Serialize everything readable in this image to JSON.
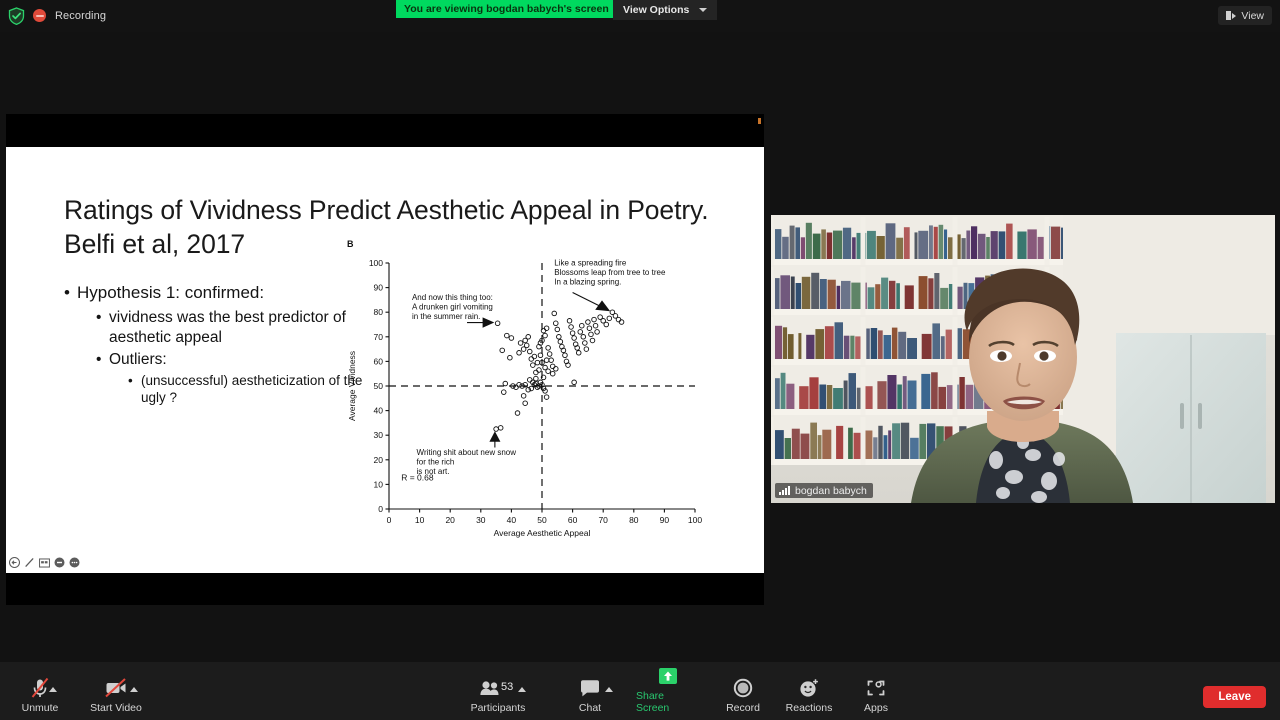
{
  "topbar": {
    "shield_icon": "shield-check-icon",
    "recording_icon": "recording-dot-icon",
    "recording_label": "Recording",
    "viewing_banner": "You are viewing bogdan babych's screen",
    "view_options_label": "View Options",
    "chevron_icon": "chevron-down-icon",
    "view_pill_label": "View",
    "view_pill_icon": "layout-view-icon"
  },
  "slide": {
    "title": "Ratings of Vividness Predict Aesthetic Appeal in Poetry. Belfi et al, 2017",
    "bullets": [
      {
        "level": 1,
        "text": "Hypothesis 1: confirmed:"
      },
      {
        "level": 2,
        "text": "vividness was the best predictor of aesthetic appeal"
      },
      {
        "level": 2,
        "text": "Outliers:"
      },
      {
        "level": 3,
        "text": "(unsuccessful) aestheticization of the ugly ?"
      }
    ],
    "ppt_toolbar_icons": [
      "pointer-icon",
      "pen-icon",
      "slides-grid-icon",
      "zoom-icon",
      "more-options-icon"
    ]
  },
  "chart_data": {
    "type": "scatter",
    "panel_label": "B",
    "title": "",
    "xlabel": "Average Aesthetic Appeal",
    "ylabel": "Average Vividness",
    "xlim": [
      0,
      100
    ],
    "ylim": [
      0,
      100
    ],
    "xticks": [
      0,
      10,
      20,
      30,
      40,
      50,
      60,
      70,
      80,
      90,
      100
    ],
    "yticks": [
      0,
      10,
      20,
      30,
      40,
      50,
      60,
      70,
      80,
      90,
      100
    ],
    "grid": false,
    "reference_lines": [
      {
        "orientation": "horizontal",
        "value": 50,
        "style": "dashed"
      },
      {
        "orientation": "vertical",
        "value": 50,
        "style": "dashed"
      }
    ],
    "stat_label": "R = 0.68",
    "marker": "open-circle",
    "annotations": [
      {
        "text": "And now this thing too:\nA drunken girl vomiting\nin the summer rain.",
        "points_to": [
          35.5,
          75.5
        ],
        "position": "left"
      },
      {
        "text": "Like a spreading fire\nBlossoms leap from tree to tree\nIn a blazing spring.",
        "points_to": [
          73,
          80
        ],
        "position": "top-right"
      },
      {
        "text": "Writing shit about new snow\nfor the rich\nis not art.",
        "points_to": [
          35.5,
          32.5
        ],
        "position": "bottom-left"
      }
    ],
    "points": [
      [
        35.5,
        75.5
      ],
      [
        38.5,
        70.5
      ],
      [
        40.0,
        69.5
      ],
      [
        37.0,
        64.5
      ],
      [
        39.5,
        61.5
      ],
      [
        42.5,
        63.5
      ],
      [
        43.0,
        67.5
      ],
      [
        44.0,
        65.0
      ],
      [
        44.5,
        68.5
      ],
      [
        45.0,
        66.5
      ],
      [
        45.5,
        70.0
      ],
      [
        46.0,
        64.0
      ],
      [
        46.5,
        61.0
      ],
      [
        47.0,
        58.5
      ],
      [
        47.5,
        62.0
      ],
      [
        48.0,
        55.5
      ],
      [
        48.5,
        59.5
      ],
      [
        49.0,
        66.0
      ],
      [
        49.5,
        67.5
      ],
      [
        50.0,
        68.5
      ],
      [
        50.5,
        72.5
      ],
      [
        51.0,
        70.5
      ],
      [
        51.5,
        73.5
      ],
      [
        52.0,
        65.5
      ],
      [
        52.5,
        63.0
      ],
      [
        53.0,
        60.5
      ],
      [
        53.5,
        58.0
      ],
      [
        54.0,
        79.5
      ],
      [
        54.5,
        75.5
      ],
      [
        55.0,
        73.0
      ],
      [
        55.5,
        70.0
      ],
      [
        56.0,
        68.0
      ],
      [
        56.5,
        66.0
      ],
      [
        57.0,
        64.5
      ],
      [
        57.5,
        62.5
      ],
      [
        58.0,
        60.0
      ],
      [
        58.5,
        58.5
      ],
      [
        59.0,
        76.5
      ],
      [
        59.5,
        74.0
      ],
      [
        60.0,
        71.5
      ],
      [
        60.5,
        69.5
      ],
      [
        61.0,
        67.0
      ],
      [
        61.5,
        65.5
      ],
      [
        62.0,
        63.5
      ],
      [
        62.5,
        72.0
      ],
      [
        63.0,
        74.5
      ],
      [
        63.5,
        70.0
      ],
      [
        64.0,
        67.5
      ],
      [
        64.5,
        65.0
      ],
      [
        65.0,
        76.0
      ],
      [
        65.5,
        73.5
      ],
      [
        66.0,
        71.0
      ],
      [
        66.5,
        68.5
      ],
      [
        67.0,
        77.0
      ],
      [
        67.5,
        74.5
      ],
      [
        68.0,
        72.0
      ],
      [
        69.0,
        78.0
      ],
      [
        70.0,
        76.5
      ],
      [
        71.0,
        75.0
      ],
      [
        72.0,
        77.5
      ],
      [
        73.0,
        80.0
      ],
      [
        74.0,
        78.5
      ],
      [
        75.0,
        77.0
      ],
      [
        76.0,
        76.0
      ],
      [
        38.0,
        51.0
      ],
      [
        40.5,
        50.0
      ],
      [
        41.5,
        49.5
      ],
      [
        42.5,
        50.5
      ],
      [
        43.5,
        50.0
      ],
      [
        44.5,
        50.5
      ],
      [
        45.5,
        48.5
      ],
      [
        46.5,
        49.0
      ],
      [
        47.5,
        50.5
      ],
      [
        48.0,
        51.0
      ],
      [
        48.5,
        49.5
      ],
      [
        49.0,
        50.0
      ],
      [
        49.5,
        51.5
      ],
      [
        50.0,
        50.5
      ],
      [
        50.5,
        49.0
      ],
      [
        51.0,
        48.0
      ],
      [
        51.5,
        45.5
      ],
      [
        60.5,
        51.5
      ],
      [
        37.5,
        47.5
      ],
      [
        44.0,
        46.0
      ],
      [
        44.5,
        43.0
      ],
      [
        42.0,
        39.0
      ],
      [
        35.0,
        32.5
      ],
      [
        36.5,
        33.0
      ],
      [
        50.5,
        53.5
      ],
      [
        49.0,
        56.5
      ],
      [
        48.0,
        53.0
      ],
      [
        47.0,
        51.5
      ],
      [
        46.0,
        52.5
      ],
      [
        53.5,
        55.0
      ],
      [
        54.5,
        57.0
      ],
      [
        52.0,
        56.0
      ],
      [
        51.0,
        57.5
      ],
      [
        50.0,
        59.5
      ],
      [
        49.5,
        62.5
      ],
      [
        51.5,
        60.5
      ]
    ]
  },
  "video": {
    "participant_name": "bogdan babych",
    "signal_icon": "signal-strength-icon"
  },
  "bottombar": {
    "controls": [
      {
        "label": "Unmute",
        "icon": "microphone-muted-icon",
        "has_caret": true,
        "active": false
      },
      {
        "label": "Start Video",
        "icon": "camera-muted-icon",
        "has_caret": true,
        "active": false
      },
      {
        "label": "Participants",
        "icon": "participants-icon",
        "has_caret": true,
        "badge": "53",
        "active": false
      },
      {
        "label": "Chat",
        "icon": "chat-bubble-icon",
        "has_caret": true,
        "active": false
      },
      {
        "label": "Share Screen",
        "icon": "share-screen-icon",
        "has_caret": false,
        "active": true
      },
      {
        "label": "Record",
        "icon": "record-circle-icon",
        "has_caret": false,
        "active": false
      },
      {
        "label": "Reactions",
        "icon": "reactions-smiley-icon",
        "has_caret": false,
        "active": false
      },
      {
        "label": "Apps",
        "icon": "apps-bracket-icon",
        "has_caret": false,
        "active": false
      }
    ],
    "leave_label": "Leave"
  },
  "colors": {
    "accent_green": "#00d95f",
    "share_green": "#29c76f",
    "leave_red": "#e02d2d",
    "bar_bg": "#1c1c1c",
    "top_bg": "#131313"
  }
}
